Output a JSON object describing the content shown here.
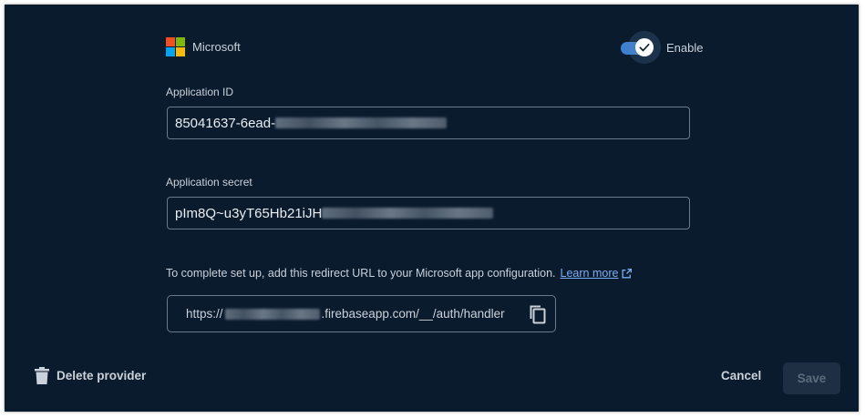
{
  "provider": {
    "name": "Microsoft",
    "logo_colors": [
      "#f25022",
      "#7fba00",
      "#00a4ef",
      "#ffb900"
    ],
    "logo_icon": "microsoft-logo-icon"
  },
  "enable_toggle": {
    "label": "Enable",
    "checked": true,
    "accent": "#3f7fd1"
  },
  "application_id": {
    "label": "Application ID",
    "visible_value": "85041637-6ead-"
  },
  "application_secret": {
    "label": "Application secret",
    "visible_value": "pIm8Q~u3yT65Hb21iJH"
  },
  "redirect": {
    "instructions": "To complete set up, add this redirect URL to your Microsoft app configuration.",
    "learn_more": "Learn more",
    "learn_more_icon": "open-in-new-icon",
    "url_prefix": "https://",
    "url_suffix": ".firebaseapp.com/__/auth/handler",
    "copy_icon": "copy-icon"
  },
  "footer": {
    "delete_label": "Delete provider",
    "delete_icon": "trash-icon",
    "cancel_label": "Cancel",
    "save_label": "Save"
  }
}
